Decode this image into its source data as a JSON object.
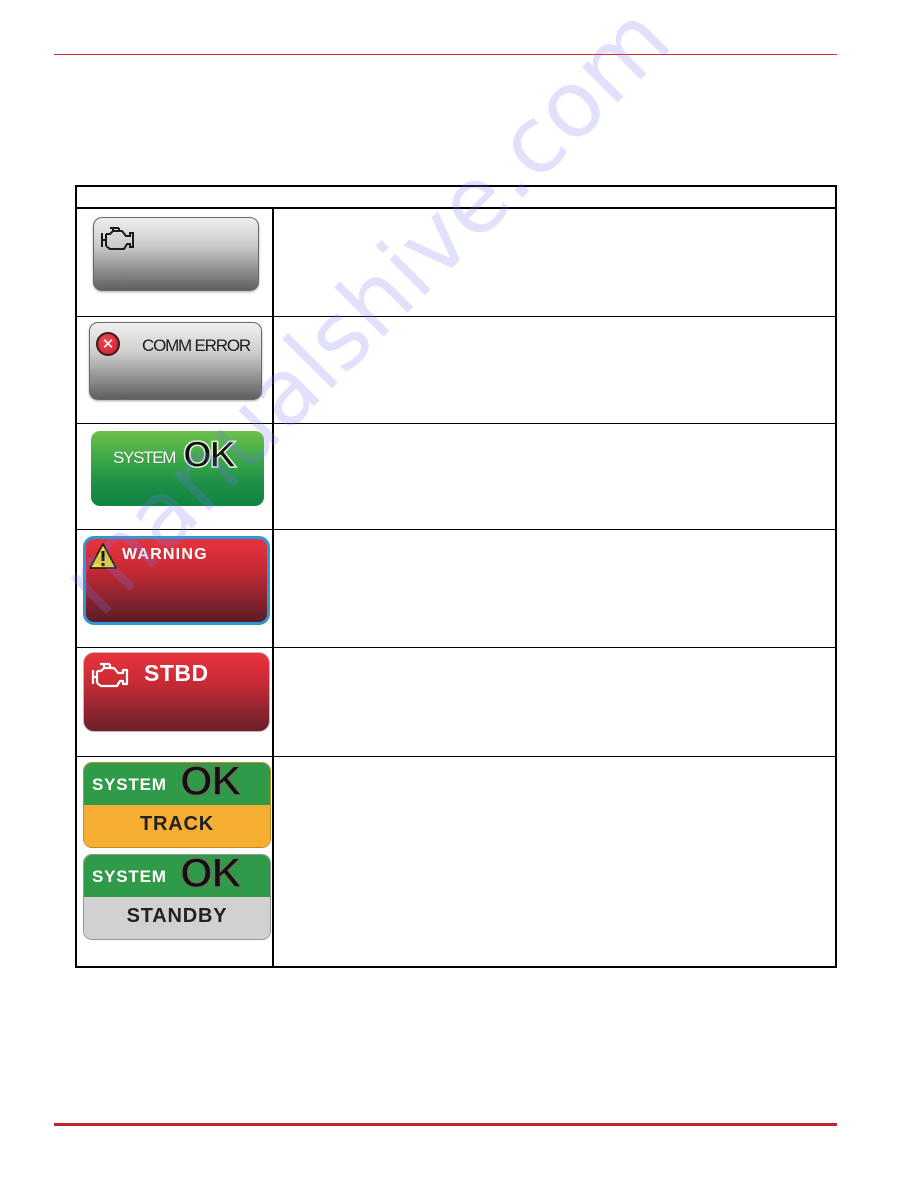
{
  "page": {
    "accent_color": "#d8252c",
    "watermark": "manualshive.com"
  },
  "table": {
    "header": "",
    "rows": [
      {
        "icon": "engine-icon",
        "badge_style": "grey",
        "badge_label": "",
        "description": ""
      },
      {
        "icon": "error-x-icon",
        "badge_style": "grey",
        "badge_label": "COMM ERROR",
        "description": ""
      },
      {
        "icon": "",
        "badge_style": "green",
        "badge_label_prefix": "SYSTEM",
        "badge_label_main": "OK",
        "description": ""
      },
      {
        "icon": "warning-triangle-icon",
        "badge_style": "red-blue-border",
        "badge_label": "WARNING",
        "description": ""
      },
      {
        "icon": "engine-icon",
        "badge_style": "red",
        "badge_label": "STBD",
        "description": ""
      },
      {
        "badges": [
          {
            "style": "green-orange",
            "prefix": "SYSTEM",
            "main": "OK",
            "mode": "TRACK"
          },
          {
            "style": "green-grey",
            "prefix": "SYSTEM",
            "main": "OK",
            "mode": "STANDBY"
          }
        ],
        "description": ""
      }
    ]
  }
}
